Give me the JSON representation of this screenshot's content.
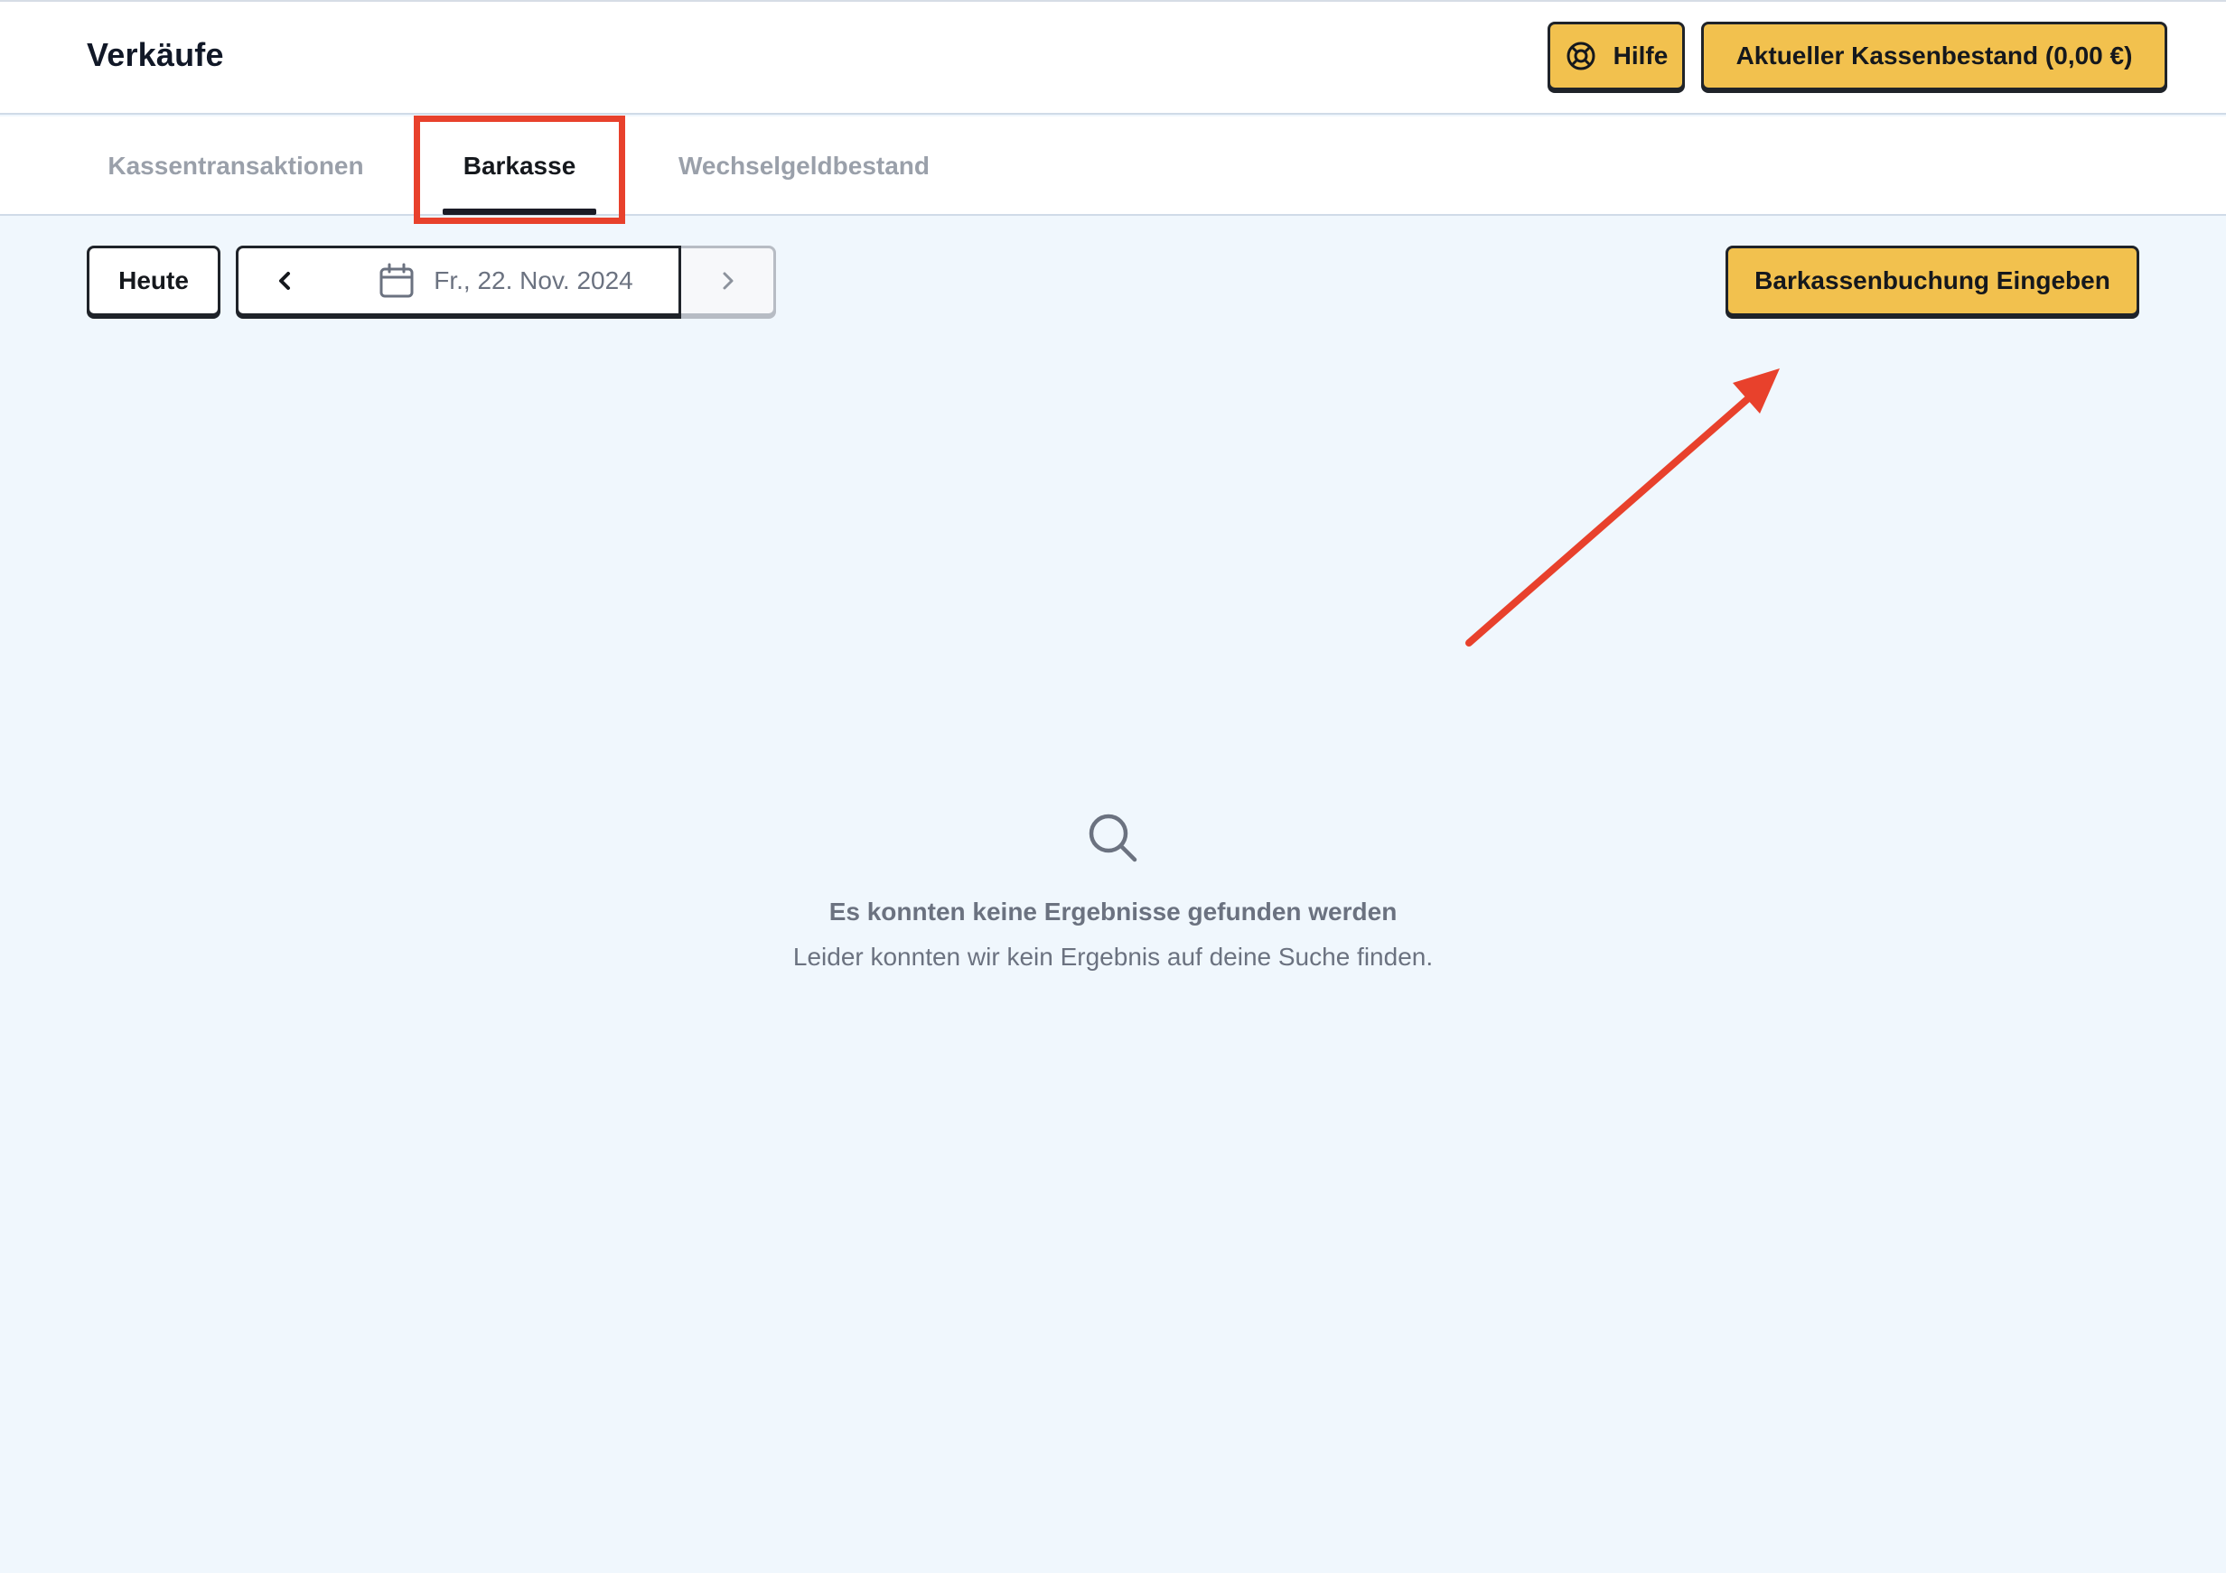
{
  "header": {
    "title": "Verkäufe",
    "help_label": "Hilfe",
    "help_icon": "lifebuoy-icon",
    "balance_label": "Aktueller Kassenbestand (0,00 €)"
  },
  "tabs": [
    {
      "label": "Kassentransaktionen",
      "active": false
    },
    {
      "label": "Barkasse",
      "active": true
    },
    {
      "label": "Wechselgeldbestand",
      "active": false
    }
  ],
  "toolbar": {
    "today_label": "Heute",
    "prev_icon": "chevron-left-icon",
    "calendar_icon": "calendar-icon",
    "date_value": "Fr., 22. Nov. 2024",
    "next_icon": "chevron-right-icon",
    "booking_label": "Barkassenbuchung Eingeben"
  },
  "empty_state": {
    "icon": "search-icon",
    "title": "Es konnten keine Ergebnisse gefunden werden",
    "subtitle": "Leider konnten wir kein Ergebnis auf deine Suche finden."
  },
  "annotations": {
    "highlight_color": "#e8412c",
    "arrow_color": "#e8412c"
  },
  "colors": {
    "accent_yellow": "#f2c14e",
    "background": "#f0f7fd",
    "text_dark": "#15181d",
    "text_muted": "#6b7280"
  }
}
